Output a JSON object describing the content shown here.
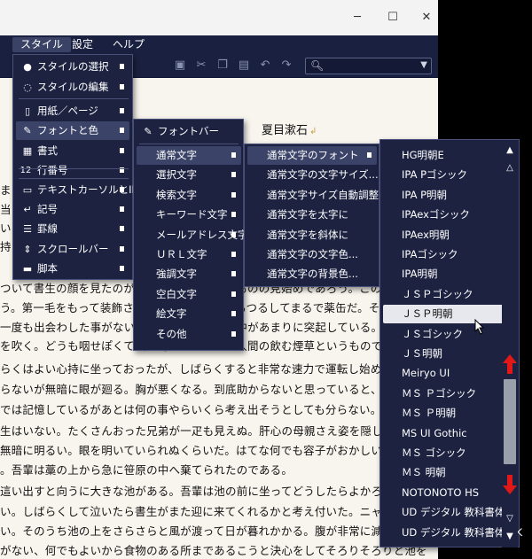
{
  "menubar": {
    "items": [
      "スタイル",
      "設定",
      "ヘルプ"
    ]
  },
  "search": {
    "placeholder": ""
  },
  "document": {
    "title": "夏目漱石",
    "lines": [
      "ま",
      "当",
      "い",
      "持",
      "ついて書生の顔を見たのがいわゆる人間というものの見始めであろう。この時妙なもの",
      "う。第一毛をもって装飾されべきはずの顔がつるつるしてまるで薬缶だ。その後猫に",
      "一度も出会わした事がない。のみならず顔の真中があまりに突起している。そうして",
      "を吹く。どうも咽せぽくて実に弱った。これが人間の飲む煙草というものである事は",
      "らくはよい心持に坐っておったが、しばらくすると非常な速力で運転し始めた。書生",
      "らないが無暗に眼が廻る。胸が悪くなる。到底助からないと思っていると、どさりと",
      "では記憶しているがあとは何の事やらいくら考え出そうとしても分らない。",
      "生はいない。たくさんおった兄弟が一疋も見えぬ。肝心の母親さえ姿を隠してしまっ",
      "無暗に明るい。眼を明いていられぬくらいだ。はてな何でも容子がおかしいと、のそ",
      "。吾輩は藁の上から急に笹原の中へ棄てられたのである。",
      "這い出すと向うに大きな池がある。吾輩は池の前に坐ってどうしたらよかろうと考え",
      "い。しばらくして泣いたら書生がまた迎に来てくれるかと考え付いた。ニャー、ニャ",
      "い。そのうち池の上をさらさらと風が渡って日が暮れかかる。腹が非常に減って来た",
      "がない、何でもよいから食物のある所まであるこうと決心をしてそろりそろりと池を",
      "苦しい。そこを我慢して無理やりに這って行くとようやくの事で何となく人間臭い所へ出た。"
    ]
  },
  "style_menu": {
    "items": [
      {
        "icon": "palette-icon",
        "label": "スタイルの選択"
      },
      {
        "icon": "palette-outline-icon",
        "label": "スタイルの編集"
      },
      {
        "icon": "page-icon",
        "label": "用紙／ページ"
      },
      {
        "icon": "font-brush-icon",
        "label": "フォントと色"
      },
      {
        "icon": "grid-icon",
        "label": "書式"
      },
      {
        "icon": "line-number-icon",
        "label": "行番号",
        "prefix": "12"
      },
      {
        "icon": "text-cursor-icon",
        "label": "テキストカーソルとIME"
      },
      {
        "icon": "return-icon",
        "label": "記号"
      },
      {
        "icon": "ruled-lines-icon",
        "label": "罫線"
      },
      {
        "icon": "scroll-icon",
        "label": "スクロールバー"
      },
      {
        "icon": "script-icon",
        "label": "脚本"
      }
    ]
  },
  "font_menu": {
    "header": "フォントバー",
    "items": [
      "通常文字",
      "選択文字",
      "検索文字",
      "キーワード文字",
      "メールアドレス文字",
      "ＵＲＬ文字",
      "強調文字",
      "空白文字",
      "絵文字",
      "その他"
    ]
  },
  "normal_menu": {
    "items": [
      "通常文字のフォント",
      "通常文字の文字サイズ...",
      "通常文字サイズ自動調整",
      "通常文字を太字に",
      "通常文字を斜体に",
      "通常文字の文字色...",
      "通常文字の背景色..."
    ]
  },
  "font_list": {
    "items": [
      "HG明朝E",
      "IPA Pゴシック",
      "IPA P明朝",
      "IPAexゴシック",
      "IPAex明朝",
      "IPAゴシック",
      "IPA明朝",
      "ＪＳＰゴシック",
      "ＪＳＰ明朝",
      "ＪＳゴシック",
      "ＪＳ明朝",
      "Meiryo UI",
      "ＭＳ Ｐゴシック",
      "ＭＳ Ｐ明朝",
      "MS UI Gothic",
      "ＭＳ ゴシック",
      "ＭＳ 明朝",
      "NOTONOTO HS",
      "UD デジタル 教科書体 N",
      "UD デジタル 教科書体 NK"
    ],
    "selected": "ＪＳＰ明朝"
  },
  "colors": {
    "menu_bg": "#1c2240",
    "highlight": "#3b4468",
    "red_arrow": "#e01818"
  }
}
